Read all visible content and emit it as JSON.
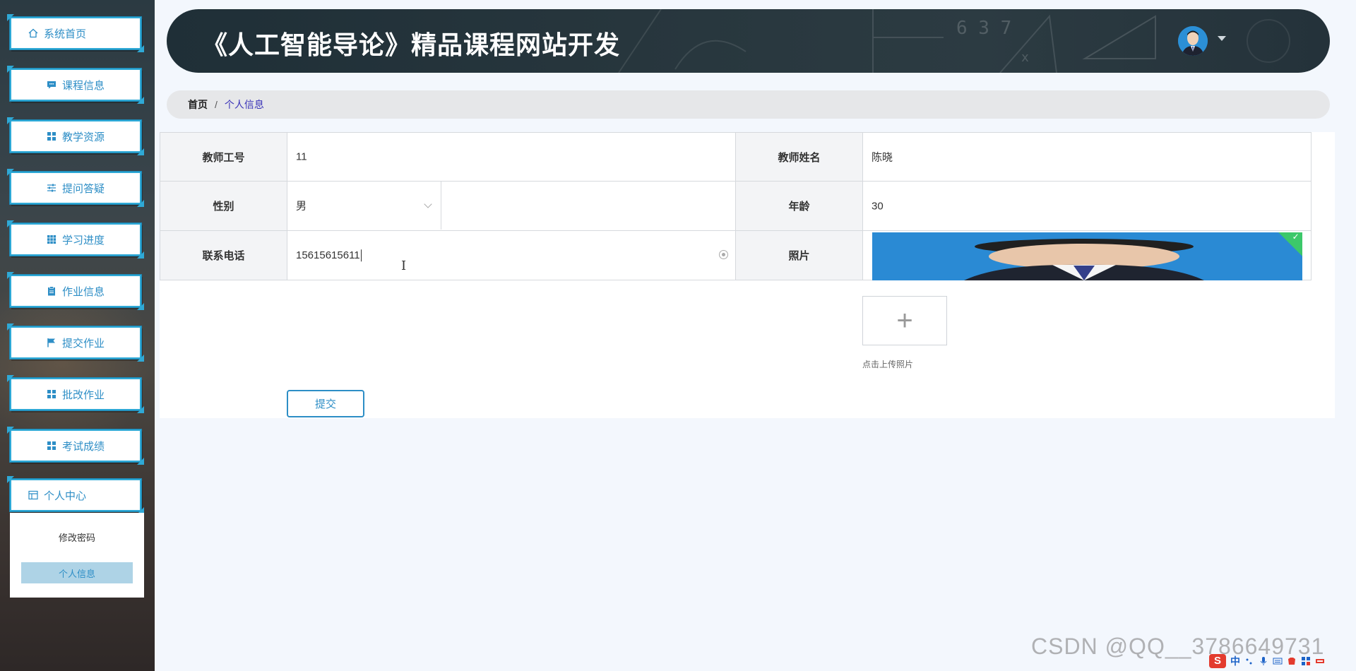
{
  "header": {
    "title": "《人工智能导论》精品课程网站开发",
    "chalk_numbers": "6 3 7",
    "chalk_x": "x",
    "avatar_icon": "user-avatar",
    "caret_icon": "caret-down-icon"
  },
  "sidebar": {
    "items": [
      {
        "label": "系统首页",
        "icon": "home-icon"
      },
      {
        "label": "课程信息",
        "icon": "chat-icon"
      },
      {
        "label": "教学资源",
        "icon": "grid-icon"
      },
      {
        "label": "提问答疑",
        "icon": "sliders-icon"
      },
      {
        "label": "学习进度",
        "icon": "grid-icon"
      },
      {
        "label": "作业信息",
        "icon": "clipboard-icon"
      },
      {
        "label": "提交作业",
        "icon": "flag-icon"
      },
      {
        "label": "批改作业",
        "icon": "grid-icon"
      },
      {
        "label": "考试成绩",
        "icon": "grid-icon"
      },
      {
        "label": "个人中心",
        "icon": "window-icon"
      }
    ],
    "submenu": [
      {
        "label": "修改密码"
      },
      {
        "label": "个人信息"
      }
    ]
  },
  "breadcrumb": {
    "home": "首页",
    "separator": "/",
    "current": "个人信息"
  },
  "form": {
    "teacher_id_label": "教师工号",
    "teacher_id_value": "11",
    "teacher_name_label": "教师姓名",
    "teacher_name_value": "陈晓",
    "gender_label": "性别",
    "gender_value": "男",
    "age_label": "年龄",
    "age_value": "30",
    "phone_label": "联系电话",
    "phone_value": "15615615611",
    "photo_label": "照片",
    "upload_plus": "+",
    "upload_tip": "点击上传照片",
    "submit_label": "提交",
    "text_cursor": "I",
    "photo_check": "✓"
  },
  "watermark": "CSDN @QQ__3786649731",
  "tray": {
    "ime_mark": "S",
    "ime_lang": "中"
  },
  "colors": {
    "accent": "#2d8ec6",
    "header_bg": "#24323a",
    "breadcrumb_current": "#3b34b8",
    "submenu_active": "#aed3e6"
  }
}
